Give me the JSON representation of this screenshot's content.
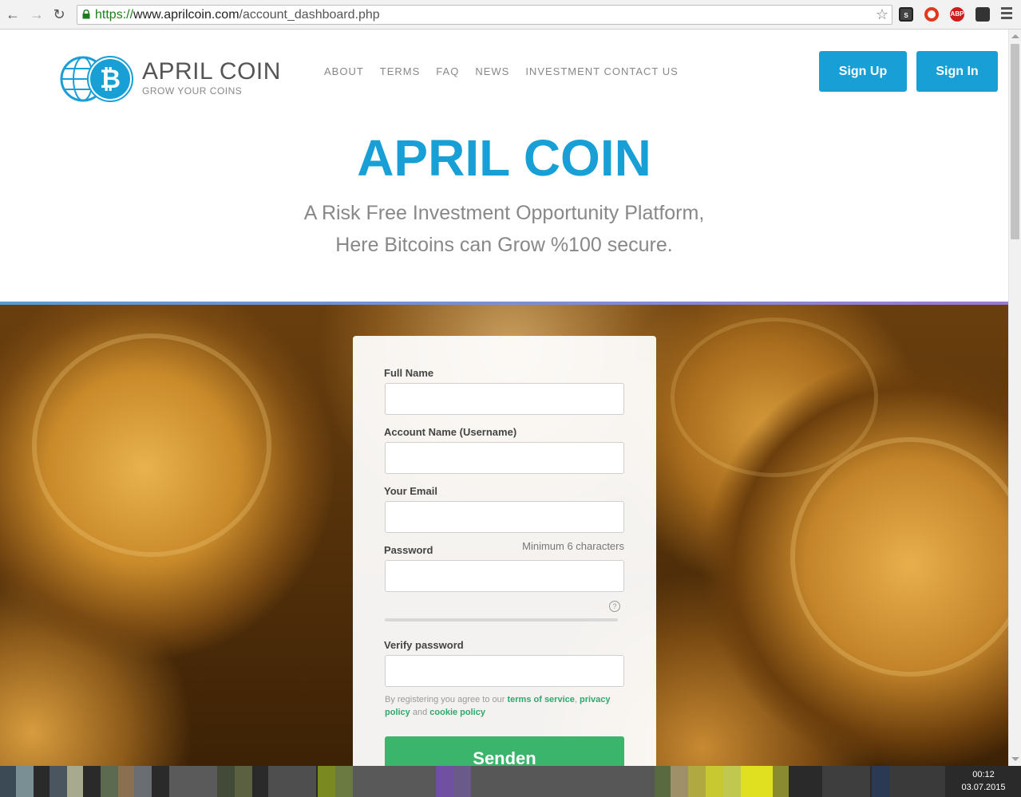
{
  "browser": {
    "url_scheme": "https://",
    "url_host": "www.aprilcoin.com",
    "url_path": "/account_dashboard.php",
    "back_glyph": "←",
    "forward_glyph": "→",
    "reload_glyph": "↻",
    "star_glyph": "☆",
    "extensions": [
      {
        "name": "s-extension-icon",
        "label": "S",
        "color": "#444444"
      },
      {
        "name": "opera-extension-icon",
        "label": "",
        "color": "#e03a1e"
      },
      {
        "name": "adblock-extension-icon",
        "label": "ABP",
        "color": "#d11a1a"
      },
      {
        "name": "ghostery-extension-icon",
        "label": "",
        "color": "#333333"
      }
    ]
  },
  "site": {
    "logo_title": "APRIL COIN",
    "logo_subtitle": "GROW YOUR COINS",
    "brand_color": "#18a0d6",
    "nav": [
      "ABOUT",
      "TERMS",
      "FAQ",
      "NEWS",
      "INVESTMENT CONTACT US"
    ],
    "signup_label": "Sign Up",
    "signin_label": "Sign In"
  },
  "hero": {
    "title": "APRIL COIN",
    "line1": "A Risk Free Investment Opportunity Platform,",
    "line2": "Here Bitcoins can Grow %100 secure."
  },
  "form": {
    "full_name_label": "Full Name",
    "full_name_value": "",
    "username_label": "Account Name (Username)",
    "username_value": "",
    "email_label": "Your Email",
    "email_value": "",
    "password_label": "Password",
    "password_hint": "Minimum 6 characters",
    "password_value": "",
    "help_glyph": "?",
    "verify_label": "Verify password",
    "verify_value": "",
    "terms_prefix": "By registering you agree to our ",
    "terms_link": "terms of service",
    "terms_sep": ", ",
    "privacy_link": "privacy policy",
    "terms_and": " and ",
    "cookie_link": "cookie policy",
    "submit_label": "Senden",
    "submit_color": "#3bb56c"
  },
  "taskbar": {
    "time": "00:12",
    "date": "03.07.2015"
  }
}
